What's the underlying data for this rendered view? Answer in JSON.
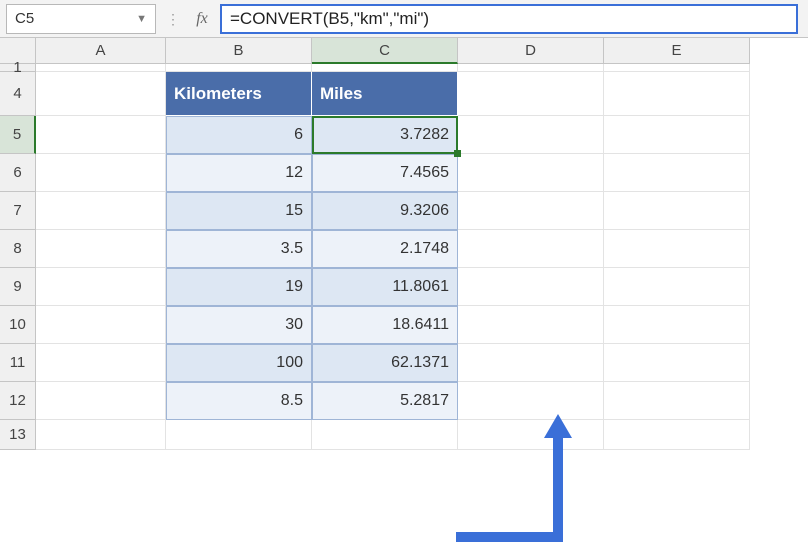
{
  "formula_bar": {
    "name_box": "C5",
    "fx_label": "fx",
    "formula": "=CONVERT(B5,\"km\",\"mi\")"
  },
  "columns": [
    "A",
    "B",
    "C",
    "D",
    "E"
  ],
  "rows": [
    "1",
    "4",
    "5",
    "6",
    "7",
    "8",
    "9",
    "10",
    "11",
    "12",
    "13"
  ],
  "table": {
    "headers": {
      "b": "Kilometers",
      "c": "Miles"
    },
    "data": [
      {
        "km": "6",
        "mi": "3.7282"
      },
      {
        "km": "12",
        "mi": "7.4565"
      },
      {
        "km": "15",
        "mi": "9.3206"
      },
      {
        "km": "3.5",
        "mi": "2.1748"
      },
      {
        "km": "19",
        "mi": "11.8061"
      },
      {
        "km": "30",
        "mi": "18.6411"
      },
      {
        "km": "100",
        "mi": "62.1371"
      },
      {
        "km": "8.5",
        "mi": "5.2817"
      }
    ]
  },
  "selected_cell": "C5"
}
